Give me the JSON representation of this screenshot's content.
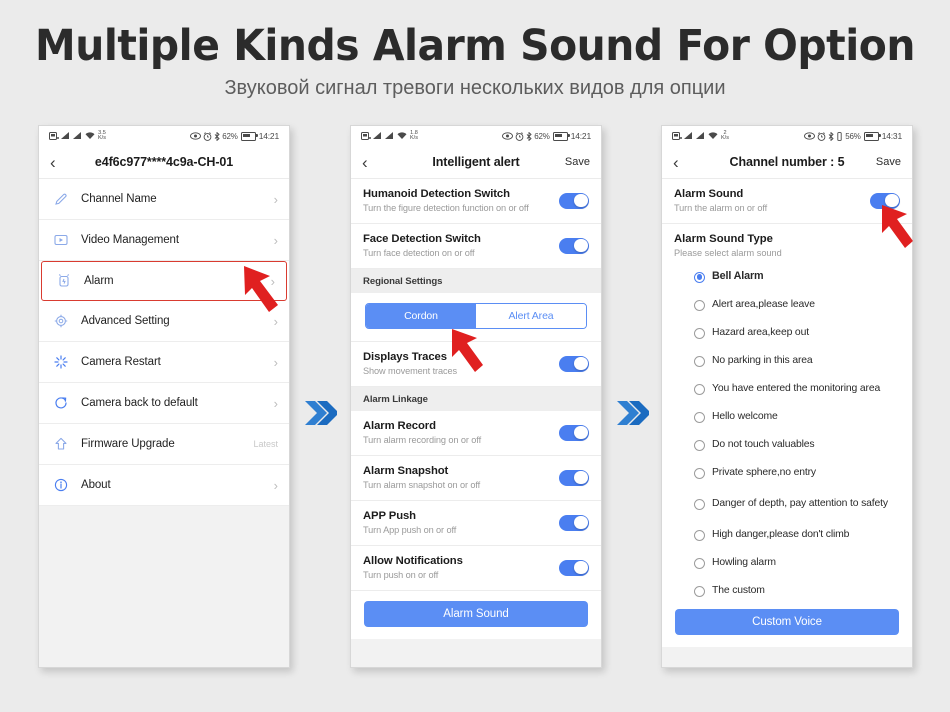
{
  "header": {
    "title": "Multiple Kinds Alarm Sound For Option",
    "subtitle": "Звуковой сигнал тревоги нескольких видов для опции"
  },
  "colors": {
    "accent_blue": "#5b8ef4",
    "toggle_blue": "#4a7ef0",
    "highlight_red": "#d93b30",
    "page_background": "#ebebeb",
    "section_gray": "#eeeeee"
  },
  "separators": {
    "icon": "double-chevron-right-icon",
    "glyph": "»"
  },
  "phone1": {
    "statusbar": {
      "rate_value": "3.5",
      "rate_unit": "K/s",
      "battery_percent": "62%",
      "time": "14:21",
      "icons": [
        "sim-card-icon",
        "signal-bars-icon",
        "signal-bars-icon",
        "wifi-icon",
        "eye-icon",
        "alarm-clock-icon",
        "bluetooth-icon",
        "battery-icon"
      ]
    },
    "nav": {
      "back": "‹",
      "title": "e4f6c977****4c9a-CH-01"
    },
    "rows": [
      {
        "label": "Channel Name",
        "icon": "pencil-icon",
        "trailing": "›",
        "trailing_type": "chevron",
        "highlighted": false
      },
      {
        "label": "Video Management",
        "icon": "video-icon",
        "trailing": "›",
        "trailing_type": "chevron",
        "highlighted": false
      },
      {
        "label": "Alarm",
        "icon": "alarm-clock-icon",
        "trailing": "›",
        "trailing_type": "chevron",
        "highlighted": true
      },
      {
        "label": "Advanced Setting",
        "icon": "gear-icon",
        "trailing": "›",
        "trailing_type": "chevron",
        "highlighted": false
      },
      {
        "label": "Camera Restart",
        "icon": "restart-icon",
        "trailing": "›",
        "trailing_type": "chevron",
        "highlighted": false
      },
      {
        "label": "Camera back to default",
        "icon": "refresh-icon",
        "trailing": "›",
        "trailing_type": "chevron",
        "highlighted": false
      },
      {
        "label": "Firmware Upgrade",
        "icon": "upload-arrow-icon",
        "trailing": "Latest",
        "trailing_type": "text",
        "highlighted": false
      },
      {
        "label": "About",
        "icon": "info-icon",
        "trailing": "›",
        "trailing_type": "chevron",
        "highlighted": false
      }
    ]
  },
  "phone2": {
    "statusbar": {
      "rate_value": "1.8",
      "rate_unit": "K/s",
      "battery_percent": "62%",
      "time": "14:21"
    },
    "nav": {
      "back": "‹",
      "title": "Intelligent alert",
      "save": "Save"
    },
    "toggles_top": [
      {
        "title": "Humanoid Detection Switch",
        "sub": "Turn the figure detection function on or off",
        "on": true
      },
      {
        "title": "Face Detection Switch",
        "sub": "Turn face detection on or off",
        "on": true
      }
    ],
    "section_regional": "Regional Settings",
    "segmented": {
      "options": [
        "Cordon",
        "Alert Area"
      ],
      "selected": "Cordon"
    },
    "traces": {
      "title": "Displays Traces",
      "sub": "Show movement traces",
      "on": true
    },
    "section_linkage": "Alarm Linkage",
    "toggles_bottom": [
      {
        "title": "Alarm Record",
        "sub": "Turn alarm recording on or off",
        "on": true
      },
      {
        "title": "Alarm Snapshot",
        "sub": "Turn alarm snapshot on or off",
        "on": true
      },
      {
        "title": "APP Push",
        "sub": "Turn App push on or off",
        "on": true
      },
      {
        "title": "Allow Notifications",
        "sub": "Turn push on or off",
        "on": true
      }
    ],
    "button": "Alarm Sound"
  },
  "phone3": {
    "statusbar": {
      "rate_value": "2",
      "rate_unit": "K/s",
      "battery_percent": "56%",
      "time": "14:31"
    },
    "nav": {
      "back": "‹",
      "title": "Channel number : 5",
      "save": "Save"
    },
    "alarm_sound": {
      "title": "Alarm Sound",
      "sub": "Turn the alarm on or off",
      "on": true
    },
    "sound_type": {
      "title": "Alarm Sound Type",
      "sub": "Please select alarm sound"
    },
    "options": [
      {
        "label": "Bell Alarm",
        "selected": true
      },
      {
        "label": "Alert area,please leave",
        "selected": false
      },
      {
        "label": "Hazard area,keep out",
        "selected": false
      },
      {
        "label": "No parking in this area",
        "selected": false
      },
      {
        "label": "You have entered the monitoring area",
        "selected": false
      },
      {
        "label": "Hello welcome",
        "selected": false
      },
      {
        "label": "Do not touch valuables",
        "selected": false
      },
      {
        "label": "Private sphere,no entry",
        "selected": false
      },
      {
        "label": "Danger of depth, pay attention to safety",
        "selected": false
      },
      {
        "label": "High danger,please don't climb",
        "selected": false
      },
      {
        "label": "Howling alarm",
        "selected": false
      },
      {
        "label": "The custom",
        "selected": false
      }
    ],
    "button": "Custom Voice"
  }
}
